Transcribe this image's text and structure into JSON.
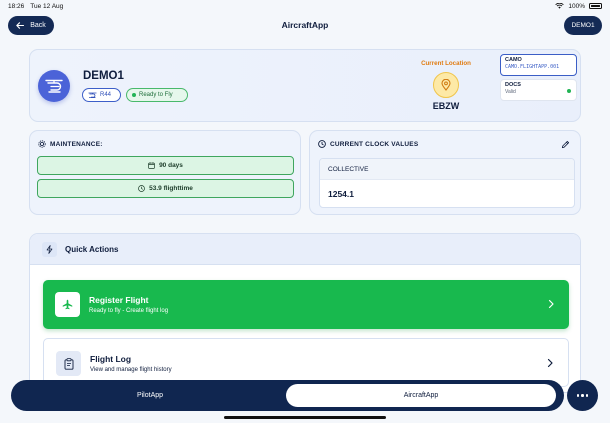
{
  "status_bar": {
    "time": "18:26",
    "date": "Tue 12 Aug",
    "battery": "100%"
  },
  "nav": {
    "back_label": "Back",
    "title": "AircraftApp",
    "account_label": "DEMO1"
  },
  "aircraft": {
    "name": "DEMO1",
    "model": "R44",
    "status": "Ready to Fly",
    "location_label": "Current Location",
    "location_code": "EBZW",
    "camo_title": "CAMO",
    "camo_value": "CAMO.FLIGHTAPP.001",
    "docs_title": "DOCS",
    "docs_value": "Valid"
  },
  "maintenance": {
    "heading": "MAINTENANCE:",
    "items": [
      {
        "label": "90 days",
        "icon": "calendar-icon"
      },
      {
        "label": "53.9 flighttime",
        "icon": "clock-icon"
      }
    ]
  },
  "clock": {
    "heading": "CURRENT CLOCK VALUES",
    "column": "COLLECTIVE",
    "value": "1254.1"
  },
  "quick_actions": {
    "heading": "Quick Actions",
    "register": {
      "title": "Register Flight",
      "subtitle": "Ready to fly - Create flight log"
    },
    "log": {
      "title": "Flight Log",
      "subtitle": "View and manage flight history"
    }
  },
  "tabs": {
    "pilot": "PilotApp",
    "aircraft": "AircraftApp"
  },
  "colors": {
    "navy": "#102650",
    "green": "#18b94e",
    "accent_blue": "#4b63d8",
    "orange": "#e07b10"
  }
}
